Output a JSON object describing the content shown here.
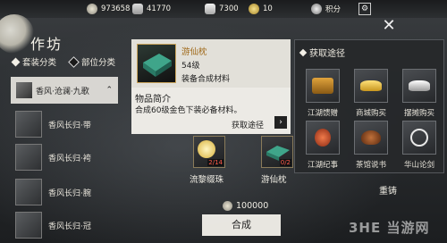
{
  "topbar": {
    "currencies": [
      {
        "icon": "coin-icon",
        "value": "973658"
      },
      {
        "icon": "silver-icon",
        "value": "41770"
      },
      {
        "icon": "ingot-icon",
        "value": "7300"
      },
      {
        "icon": "token-icon",
        "value": "10"
      },
      {
        "icon": "points-icon",
        "value": "积分"
      }
    ]
  },
  "title": "作坊",
  "tabs": [
    "套装分类",
    "部位分类"
  ],
  "category": {
    "label": "香风·沧澜·九歌"
  },
  "items": [
    {
      "label": "香风长归·带"
    },
    {
      "label": "香风长归·袴"
    },
    {
      "label": "香风长归·腕"
    },
    {
      "label": "香风长归·冠"
    }
  ],
  "detail": {
    "name": "游仙枕",
    "level": "54级",
    "type": "装备合成材料",
    "intro_title": "物品简介",
    "intro_text": "合成60级金色下装必备材料。",
    "source_link": "获取途径"
  },
  "materials": [
    {
      "name": "流黎缀珠",
      "qty": "2/14"
    },
    {
      "name": "游仙枕",
      "qty": "0/2"
    }
  ],
  "source_panel": {
    "title": "获取途径",
    "entries": [
      {
        "label": "江湖馈赠",
        "icon": "treasure-chest-icon"
      },
      {
        "label": "商城购买",
        "icon": "gold-ingot-icon"
      },
      {
        "label": "摆摊购买",
        "icon": "silver-ingot-icon"
      },
      {
        "label": "江湖纪事",
        "icon": "red-pouch-icon"
      },
      {
        "label": "茶馆说书",
        "icon": "teapot-icon"
      },
      {
        "label": "华山论剑",
        "icon": "sword-emblem-icon"
      }
    ]
  },
  "cost": "100000",
  "craft_button": "合成",
  "reforge": "重铸",
  "watermark": "3HE 当游网",
  "colors": {
    "accent": "#f0ede4",
    "panel": "#26282b",
    "qty_red": "#ff5a4a"
  }
}
